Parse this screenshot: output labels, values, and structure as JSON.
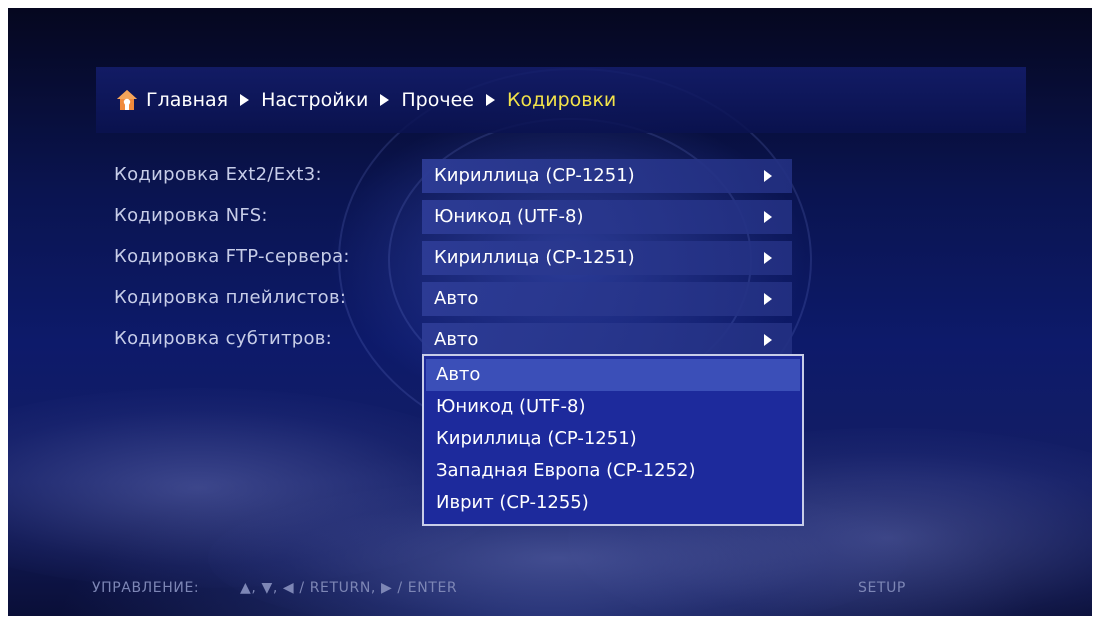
{
  "breadcrumb": {
    "items": [
      "Главная",
      "Настройки",
      "Прочее"
    ],
    "current": "Кодировки"
  },
  "settings": [
    {
      "label": "Кодировка Ext2/Ext3:",
      "value": "Кириллица (CP-1251)"
    },
    {
      "label": "Кодировка NFS:",
      "value": "Юникод (UTF-8)"
    },
    {
      "label": "Кодировка FTP-сервера:",
      "value": "Кириллица (CP-1251)"
    },
    {
      "label": "Кодировка плейлистов:",
      "value": "Авто"
    },
    {
      "label": "Кодировка субтитров:",
      "value": "Авто"
    }
  ],
  "dropdown": {
    "options": [
      "Авто",
      "Юникод (UTF-8)",
      "Кириллица (CP-1251)",
      "Западная Европа (CP-1252)",
      "Иврит (CP-1255)"
    ],
    "selected_index": 0
  },
  "footer": {
    "controls_label": "УПРАВЛЕНИЕ:",
    "keys": "▲, ▼, ◀ / RETURN, ▶ / ENTER",
    "setup": "SETUP"
  },
  "colors": {
    "accent_current": "#f2e24a",
    "home_icon": "#f08a3c"
  },
  "icons": [
    "home-icon",
    "chevron-right-icon"
  ]
}
